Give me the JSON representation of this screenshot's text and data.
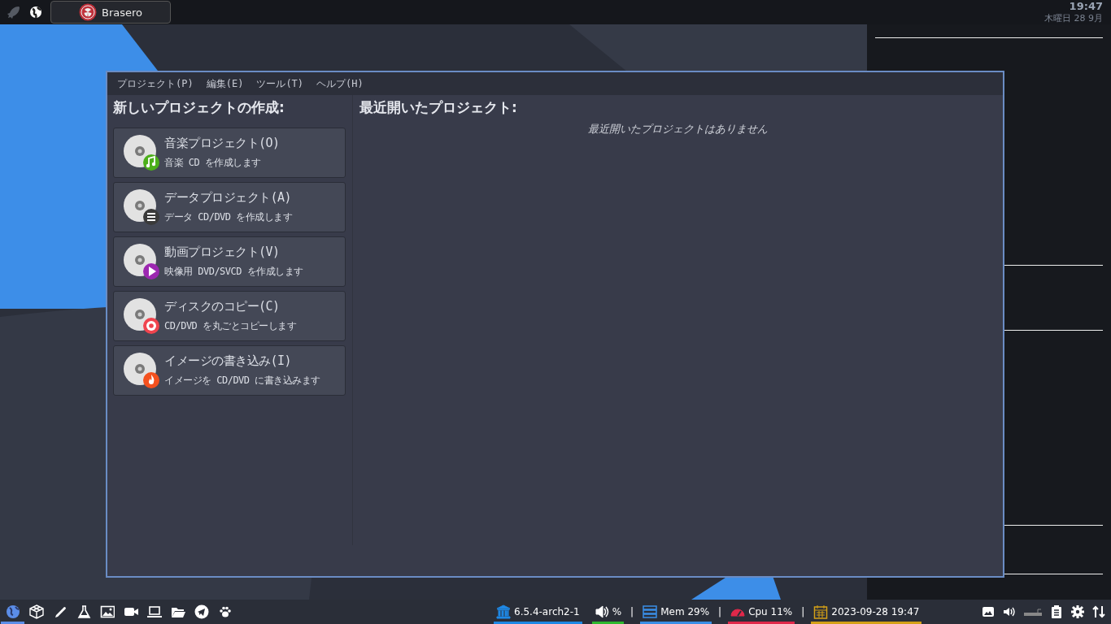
{
  "top_bar": {
    "task": {
      "label": "Brasero",
      "selected": true
    },
    "clock": {
      "time": "19:47",
      "date": "木曜日 28 9月"
    }
  },
  "window": {
    "menu": [
      "プロジェクト(P)",
      "編集(E)",
      "ツール(T)",
      "ヘルプ(H)"
    ],
    "new_project": {
      "title": "新しいプロジェクトの作成:",
      "items": [
        {
          "kind": "audio",
          "title": "音楽プロジェクト(O)",
          "subtitle": "音楽 CD を作成します"
        },
        {
          "kind": "data",
          "title": "データプロジェクト(A)",
          "subtitle": "データ CD/DVD を作成します"
        },
        {
          "kind": "video",
          "title": "動画プロジェクト(V)",
          "subtitle": "映像用 DVD/SVCD を作成します"
        },
        {
          "kind": "copy",
          "title": "ディスクのコピー(C)",
          "subtitle": "CD/DVD を丸ごとコピーします"
        },
        {
          "kind": "image",
          "title": "イメージの書き込み(I)",
          "subtitle": "イメージを CD/DVD に書き込みます"
        }
      ]
    },
    "recent": {
      "title": "最近開いたプロジェクト:",
      "empty_message": "最近開いたプロジェクトはありません"
    }
  },
  "bottom_bar": {
    "launchers": [
      {
        "selected": true
      },
      {
        "selected": false
      },
      {
        "selected": false
      },
      {
        "selected": false
      },
      {
        "selected": false
      },
      {
        "selected": false
      },
      {
        "selected": false
      },
      {
        "selected": false
      },
      {
        "selected": false
      },
      {
        "selected": false
      }
    ],
    "status": [
      {
        "kind": "kernel",
        "text": "6.5.4-arch2-1",
        "color": "#1e88e5"
      },
      {
        "kind": "volume",
        "text": "%",
        "color": "#2eb82e"
      },
      {
        "kind": "memory",
        "text": "Mem 29%",
        "color": "#3a8ee6",
        "separator_before": "|"
      },
      {
        "kind": "cpu",
        "text": "Cpu  11%",
        "color": "#e0284a",
        "separator_before": "|"
      },
      {
        "kind": "date",
        "text": "2023-09-28 19:47",
        "color": "#d4a017",
        "separator_before": "|"
      }
    ]
  }
}
